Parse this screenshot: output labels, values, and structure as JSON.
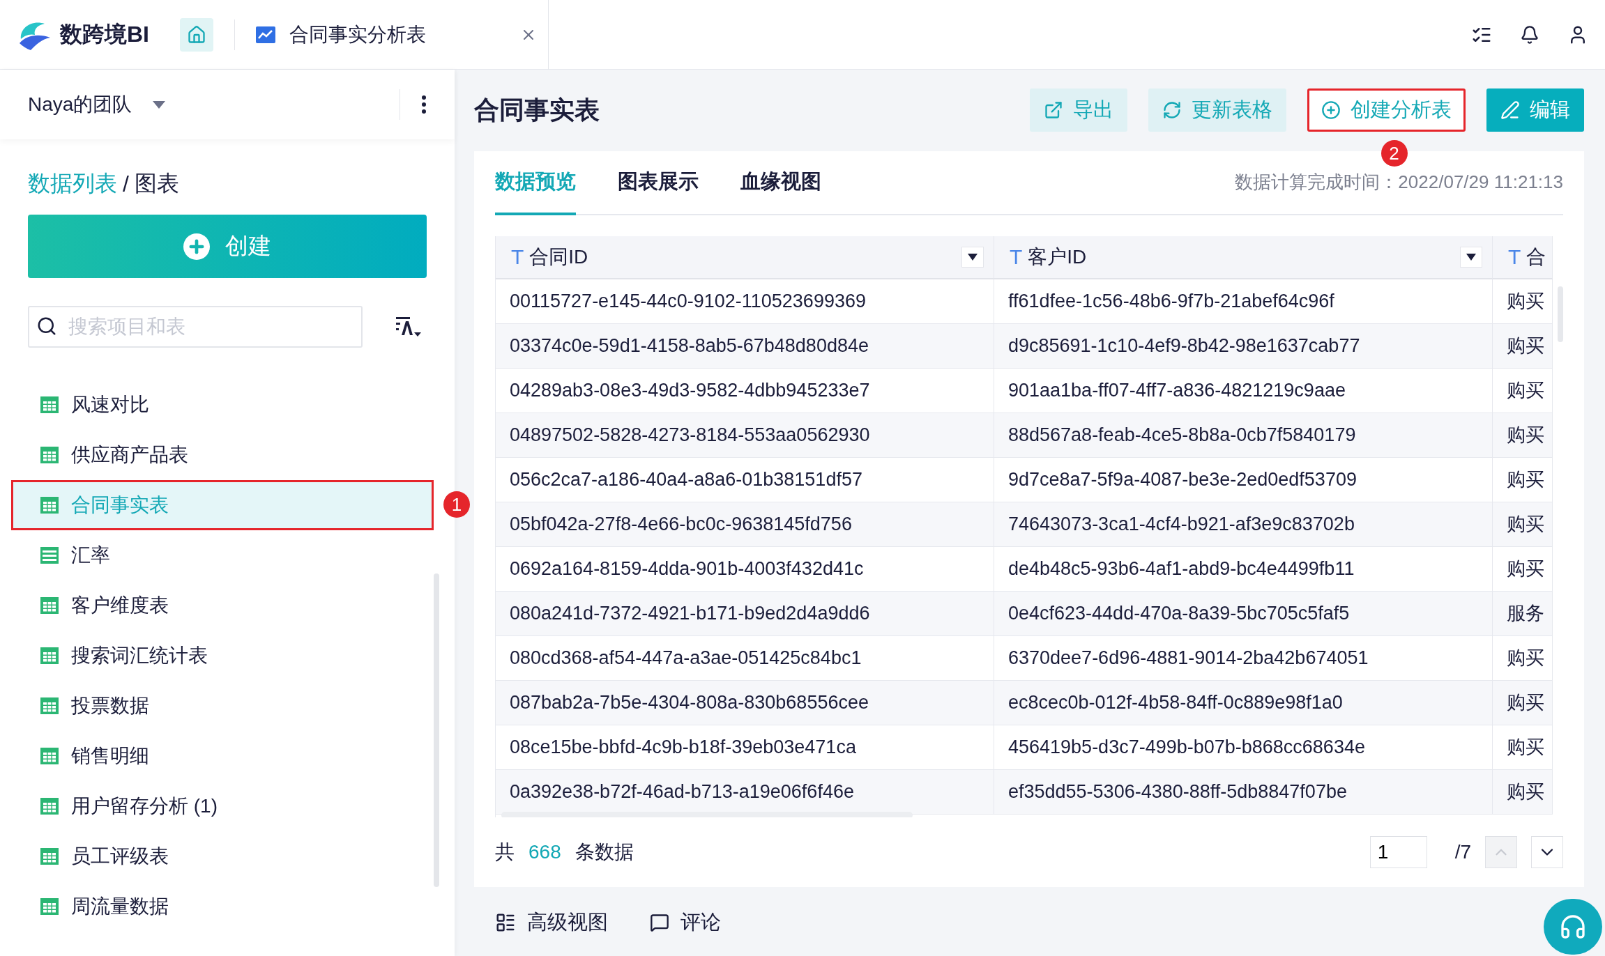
{
  "app": {
    "name": "数跨境BI"
  },
  "open_tabs": [
    {
      "label": "合同事实分析表",
      "selected": true
    }
  ],
  "sidebar": {
    "team": "Naya的团队",
    "breadcrumb": {
      "parent": "数据列表",
      "separator": "/",
      "current": "图表"
    },
    "create_button": "创建",
    "search": {
      "placeholder": "搜索项目和表"
    },
    "items": [
      {
        "label": "风速对比",
        "kind": "table",
        "selected": false,
        "highlighted": false
      },
      {
        "label": "供应商产品表",
        "kind": "table",
        "selected": false,
        "highlighted": false
      },
      {
        "label": "合同事实表",
        "kind": "table",
        "selected": true,
        "highlighted": true,
        "callout": "1"
      },
      {
        "label": "汇率",
        "kind": "list",
        "selected": false,
        "highlighted": false
      },
      {
        "label": "客户维度表",
        "kind": "table",
        "selected": false,
        "highlighted": false
      },
      {
        "label": "搜索词汇统计表",
        "kind": "table",
        "selected": false,
        "highlighted": false
      },
      {
        "label": "投票数据",
        "kind": "table",
        "selected": false,
        "highlighted": false
      },
      {
        "label": "销售明细",
        "kind": "table",
        "selected": false,
        "highlighted": false
      },
      {
        "label": "用户留存分析 (1)",
        "kind": "table",
        "selected": false,
        "highlighted": false
      },
      {
        "label": "员工评级表",
        "kind": "table",
        "selected": false,
        "highlighted": false
      },
      {
        "label": "周流量数据",
        "kind": "table",
        "selected": false,
        "highlighted": false
      }
    ]
  },
  "main": {
    "title": "合同事实表",
    "actions": [
      {
        "label": "导出",
        "kind": "export",
        "highlighted": false
      },
      {
        "label": "更新表格",
        "kind": "refresh",
        "highlighted": false
      },
      {
        "label": "创建分析表",
        "kind": "create",
        "highlighted": true,
        "callout": "2"
      },
      {
        "label": "编辑",
        "kind": "edit",
        "highlighted": false
      }
    ],
    "tabs": [
      {
        "label": "数据预览",
        "selected": true
      },
      {
        "label": "图表展示",
        "selected": false
      },
      {
        "label": "血缘视图",
        "selected": false
      }
    ],
    "computed_time": "数据计算完成时间：2022/07/29 11:21:13",
    "table": {
      "columns": [
        {
          "label": "合同ID",
          "type": "T"
        },
        {
          "label": "客户ID",
          "type": "T"
        },
        {
          "label": "合",
          "type": "T"
        }
      ],
      "rows": [
        [
          "00115727-e145-44c0-9102-110523699369",
          "ff61dfee-1c56-48b6-9f7b-21abef64c96f",
          "购买"
        ],
        [
          "03374c0e-59d1-4158-8ab5-67b48d80d84e",
          "d9c85691-1c10-4ef9-8b42-98e1637cab77",
          "购买"
        ],
        [
          "04289ab3-08e3-49d3-9582-4dbb945233e7",
          "901aa1ba-ff07-4ff7-a836-4821219c9aae",
          "购买"
        ],
        [
          "04897502-5828-4273-8184-553aa0562930",
          "88d567a8-feab-4ce5-8b8a-0cb7f5840179",
          "购买"
        ],
        [
          "056c2ca7-a186-40a4-a8a6-01b38151df57",
          "9d7ce8a7-5f9a-4087-be3e-2ed0edf53709",
          "购买"
        ],
        [
          "05bf042a-27f8-4e66-bc0c-9638145fd756",
          "74643073-3ca1-4cf4-b921-af3e9c83702b",
          "购买"
        ],
        [
          "0692a164-8159-4dda-901b-4003f432d41c",
          "de4b48c5-93b6-4af1-abd9-bc4e4499fb11",
          "购买"
        ],
        [
          "080a241d-7372-4921-b171-b9ed2d4a9dd6",
          "0e4cf623-44dd-470a-8a39-5bc705c5faf5",
          "服务"
        ],
        [
          "080cd368-af54-447a-a3ae-051425c84bc1",
          "6370dee7-6d96-4881-9014-2ba42b674051",
          "购买"
        ],
        [
          "087bab2a-7b5e-4304-808a-830b68556cee",
          "ec8cec0b-012f-4b58-84ff-0c889e98f1a0",
          "购买"
        ],
        [
          "08ce15be-bbfd-4c9b-b18f-39eb03e471ca",
          "456419b5-d3c7-499b-b07b-b868cc68634e",
          "购买"
        ],
        [
          "0a392e38-b72f-46ad-b713-a19e06f6f46e",
          "ef35dd55-5306-4380-88ff-5db8847f07be",
          "购买"
        ]
      ]
    },
    "footer": {
      "prefix": "共",
      "count": "668",
      "suffix": "条数据",
      "page": "1",
      "pages": "/7",
      "prev_disabled": true
    },
    "bottom_tabs": [
      {
        "label": "高级视图",
        "kind": "view"
      },
      {
        "label": "评论",
        "kind": "comment"
      }
    ]
  }
}
